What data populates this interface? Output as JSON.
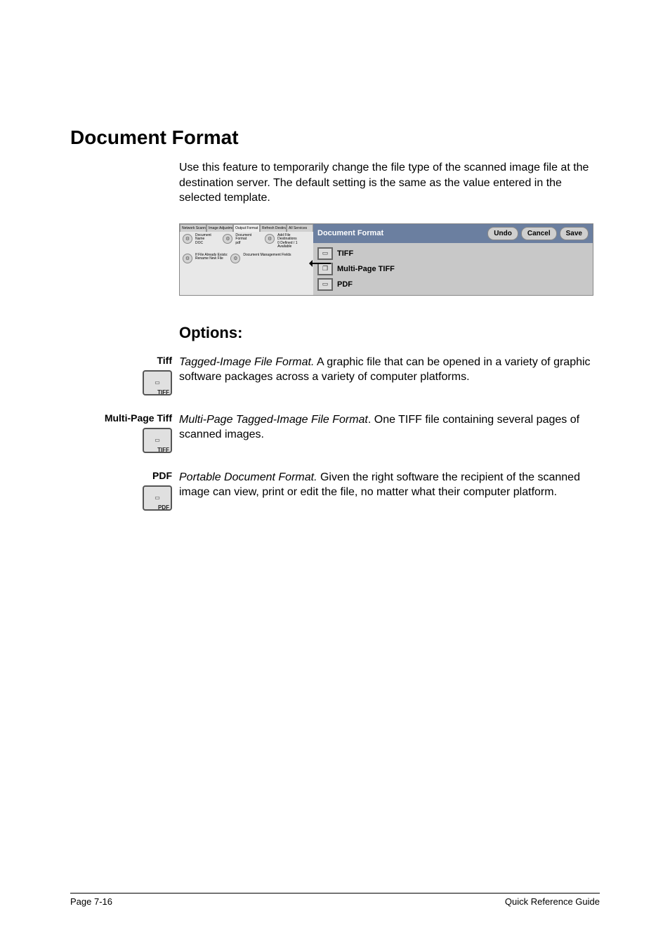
{
  "heading": "Document Format",
  "intro": "Use this feature to temporarily change the file type of the scanned image file at the destination server. The default setting is the same as the value entered in the selected template.",
  "mock": {
    "tabs": [
      "Network Scanning",
      "Image Adjustment",
      "Output Format",
      "Refresh Destinations",
      "All Services"
    ],
    "left_items": [
      {
        "label1": "Document Name",
        "label2": "DOC"
      },
      {
        "label1": "Document Format",
        "label2": "pdf"
      },
      {
        "label1": "Add File Destinations",
        "label2": "0 Defined / 1 Available"
      },
      {
        "label1": "If File Already Exists:",
        "label2": "Rename New File"
      },
      {
        "label1": "Document Management Fields",
        "label2": ""
      }
    ],
    "panel_title": "Document Format",
    "buttons": {
      "undo": "Undo",
      "cancel": "Cancel",
      "save": "Save"
    },
    "options": [
      {
        "label": "TIFF"
      },
      {
        "label": "Multi-Page TIFF"
      },
      {
        "label": "PDF"
      }
    ]
  },
  "options_heading": "Options:",
  "options_list": [
    {
      "name": "Tiff",
      "em": "Tagged-Image File Format.",
      "rest": " A graphic file that can be opened in a variety of graphic software packages across a variety of computer platforms.",
      "icon_class": "ic-tiff"
    },
    {
      "name": "Multi-Page Tiff",
      "em": "Multi-Page Tagged-Image File Format",
      "rest": ". One TIFF file containing several pages of scanned images.",
      "icon_class": "ic-mtiff"
    },
    {
      "name": "PDF",
      "em": "Portable Document Format.",
      "rest": " Given the right software the recipient of the scanned image can view, print or edit the file, no matter what their computer platform.",
      "icon_class": "ic-pdf"
    }
  ],
  "footer": {
    "left": "Page 7-16",
    "right": "Quick Reference Guide"
  }
}
